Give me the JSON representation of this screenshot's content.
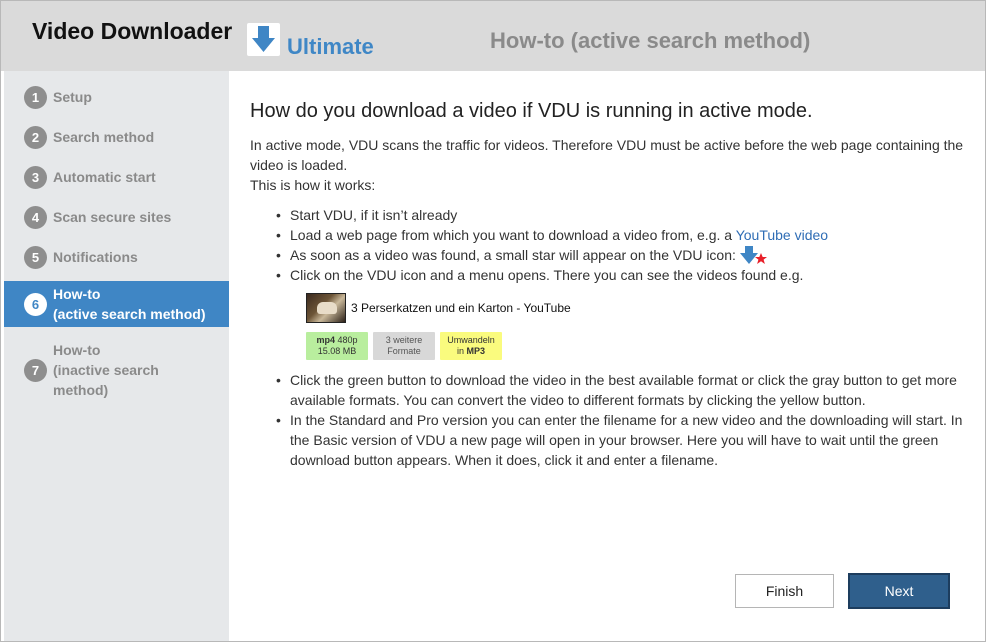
{
  "header": {
    "brand_title": "Video Downloader",
    "brand_edition": "Ultimate",
    "page_heading": "How-to (active search method)",
    "logo_icon": "download-arrow-icon"
  },
  "sidebar": {
    "items": [
      {
        "num": "1",
        "label": "Setup",
        "active": false
      },
      {
        "num": "2",
        "label": "Search method",
        "active": false
      },
      {
        "num": "3",
        "label": "Automatic start",
        "active": false
      },
      {
        "num": "4",
        "label": "Scan secure sites",
        "active": false
      },
      {
        "num": "5",
        "label": "Notifications",
        "active": false
      },
      {
        "num": "6",
        "label": "How-to\n(active search method)",
        "active": true
      },
      {
        "num": "7",
        "label": "How-to\n(inactive search\nmethod)",
        "active": false
      }
    ]
  },
  "content": {
    "heading": "How do you download a video if VDU is running in active mode.",
    "intro_1": "In active mode, VDU scans the traffic for videos. Therefore VDU must be active before the web page containing the video is loaded.",
    "intro_2": "This is how it works:",
    "bullets": {
      "b1": "Start VDU, if it isn’t already",
      "b2_pre": "Load a web page from which you want to download a video from, e.g. a ",
      "b2_link": "YouTube video",
      "b3": "As soon as a video was found, a small star will appear on the VDU icon: ",
      "b4": "Click on the VDU icon and a menu opens. There you can see the videos found e.g.",
      "b5": "Click the green button to download the video in the best available format or click the gray button to get more available formats. You can convert the video to different formats by clicking the yellow button.",
      "b6": "In the Standard and Pro version you can enter the filename for a new video and the downloading will start. In the Basic version of VDU a new page will open in your browser. Here you will have to wait until the green download button appears. When it does, click it and enter a filename."
    },
    "example": {
      "video_title": "3 Perserkatzen und ein Karton - YouTube",
      "green_fmt": "mp4",
      "green_res": "480p",
      "green_size": "15.08 MB",
      "gray_line1": "3 weitere",
      "gray_line2": "Formate",
      "yellow_line1": "Umwandeln",
      "yellow_in": "in ",
      "yellow_fmt": "MP3"
    }
  },
  "footer": {
    "finish_label": "Finish",
    "next_label": "Next"
  },
  "colors": {
    "accent": "#3f86c5",
    "header_bg": "#dadada",
    "sidebar_bg": "#e6e8ea",
    "next_btn": "#2f5f8c",
    "star": "#e8202a"
  }
}
